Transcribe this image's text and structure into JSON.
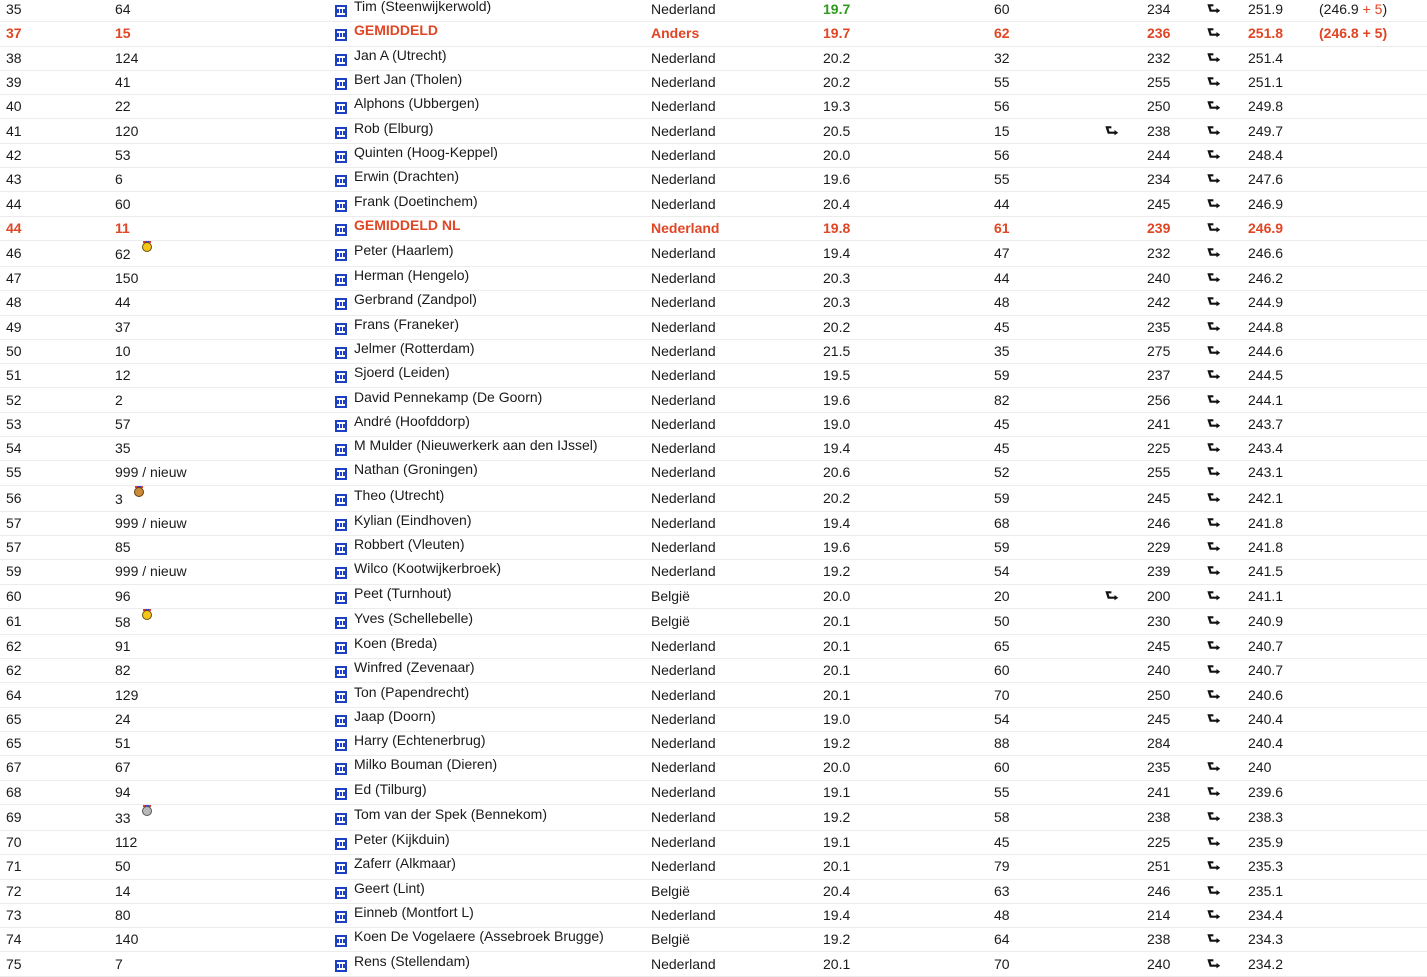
{
  "rows": [
    {
      "rank": "35",
      "pre": "64",
      "medal": "",
      "name": "Tim (Steenwijkerwold)",
      "country": "Nederland",
      "avg": "19.7",
      "n": "60",
      "a1": false,
      "score": "234",
      "a2": true,
      "total": "251.9",
      "extra": "(246.9 + 5)",
      "style": "green"
    },
    {
      "rank": "37",
      "pre": "15",
      "medal": "",
      "name": "GEMIDDELD",
      "country": "Anders",
      "avg": "19.7",
      "n": "62",
      "a1": false,
      "score": "236",
      "a2": true,
      "total": "251.8",
      "extra": "(246.8 + 5)",
      "style": "red"
    },
    {
      "rank": "38",
      "pre": "124",
      "medal": "",
      "name": "Jan A (Utrecht)",
      "country": "Nederland",
      "avg": "20.2",
      "n": "32",
      "a1": false,
      "score": "232",
      "a2": true,
      "total": "251.4",
      "extra": "",
      "style": ""
    },
    {
      "rank": "39",
      "pre": "41",
      "medal": "",
      "name": "Bert Jan (Tholen)",
      "country": "Nederland",
      "avg": "20.2",
      "n": "55",
      "a1": false,
      "score": "255",
      "a2": true,
      "total": "251.1",
      "extra": "",
      "style": ""
    },
    {
      "rank": "40",
      "pre": "22",
      "medal": "",
      "name": "Alphons (Ubbergen)",
      "country": "Nederland",
      "avg": "19.3",
      "n": "56",
      "a1": false,
      "score": "250",
      "a2": true,
      "total": "249.8",
      "extra": "",
      "style": ""
    },
    {
      "rank": "41",
      "pre": "120",
      "medal": "",
      "name": "Rob (Elburg)",
      "country": "Nederland",
      "avg": "20.5",
      "n": "15",
      "a1": true,
      "score": "238",
      "a2": true,
      "total": "249.7",
      "extra": "",
      "style": ""
    },
    {
      "rank": "42",
      "pre": "53",
      "medal": "",
      "name": "Quinten (Hoog-Keppel)",
      "country": "Nederland",
      "avg": "20.0",
      "n": "56",
      "a1": false,
      "score": "244",
      "a2": true,
      "total": "248.4",
      "extra": "",
      "style": ""
    },
    {
      "rank": "43",
      "pre": "6",
      "medal": "",
      "name": "Erwin (Drachten)",
      "country": "Nederland",
      "avg": "19.6",
      "n": "55",
      "a1": false,
      "score": "234",
      "a2": true,
      "total": "247.6",
      "extra": "",
      "style": ""
    },
    {
      "rank": "44",
      "pre": "60",
      "medal": "",
      "name": "Frank (Doetinchem)",
      "country": "Nederland",
      "avg": "20.4",
      "n": "44",
      "a1": false,
      "score": "245",
      "a2": true,
      "total": "246.9",
      "extra": "",
      "style": ""
    },
    {
      "rank": "44",
      "pre": "11",
      "medal": "",
      "name": "GEMIDDELD NL",
      "country": "Nederland",
      "avg": "19.8",
      "n": "61",
      "a1": false,
      "score": "239",
      "a2": true,
      "total": "246.9",
      "extra": "",
      "style": "red"
    },
    {
      "rank": "46",
      "pre": "62",
      "medal": "gold",
      "name": "Peter (Haarlem)",
      "country": "Nederland",
      "avg": "19.4",
      "n": "47",
      "a1": false,
      "score": "232",
      "a2": true,
      "total": "246.6",
      "extra": "",
      "style": ""
    },
    {
      "rank": "47",
      "pre": "150",
      "medal": "",
      "name": "Herman (Hengelo)",
      "country": "Nederland",
      "avg": "20.3",
      "n": "44",
      "a1": false,
      "score": "240",
      "a2": true,
      "total": "246.2",
      "extra": "",
      "style": ""
    },
    {
      "rank": "48",
      "pre": "44",
      "medal": "",
      "name": "Gerbrand (Zandpol)",
      "country": "Nederland",
      "avg": "20.3",
      "n": "48",
      "a1": false,
      "score": "242",
      "a2": true,
      "total": "244.9",
      "extra": "",
      "style": ""
    },
    {
      "rank": "49",
      "pre": "37",
      "medal": "",
      "name": "Frans (Franeker)",
      "country": "Nederland",
      "avg": "20.2",
      "n": "45",
      "a1": false,
      "score": "235",
      "a2": true,
      "total": "244.8",
      "extra": "",
      "style": ""
    },
    {
      "rank": "50",
      "pre": "10",
      "medal": "",
      "name": "Jelmer (Rotterdam)",
      "country": "Nederland",
      "avg": "21.5",
      "n": "35",
      "a1": false,
      "score": "275",
      "a2": true,
      "total": "244.6",
      "extra": "",
      "style": ""
    },
    {
      "rank": "51",
      "pre": "12",
      "medal": "",
      "name": "Sjoerd (Leiden)",
      "country": "Nederland",
      "avg": "19.5",
      "n": "59",
      "a1": false,
      "score": "237",
      "a2": true,
      "total": "244.5",
      "extra": "",
      "style": ""
    },
    {
      "rank": "52",
      "pre": "2",
      "medal": "",
      "name": "David Pennekamp (De Goorn)",
      "country": "Nederland",
      "avg": "19.6",
      "n": "82",
      "a1": false,
      "score": "256",
      "a2": true,
      "total": "244.1",
      "extra": "",
      "style": ""
    },
    {
      "rank": "53",
      "pre": "57",
      "medal": "",
      "name": "André (Hoofddorp)",
      "country": "Nederland",
      "avg": "19.0",
      "n": "45",
      "a1": false,
      "score": "241",
      "a2": true,
      "total": "243.7",
      "extra": "",
      "style": ""
    },
    {
      "rank": "54",
      "pre": "35",
      "medal": "",
      "name": "M Mulder (Nieuwerkerk aan den IJssel)",
      "country": "Nederland",
      "avg": "19.4",
      "n": "45",
      "a1": false,
      "score": "225",
      "a2": true,
      "total": "243.4",
      "extra": "",
      "style": ""
    },
    {
      "rank": "55",
      "pre": "999 / nieuw",
      "medal": "",
      "name": "Nathan (Groningen)",
      "country": "Nederland",
      "avg": "20.6",
      "n": "52",
      "a1": false,
      "score": "255",
      "a2": true,
      "total": "243.1",
      "extra": "",
      "style": ""
    },
    {
      "rank": "56",
      "pre": "3",
      "medal": "bronze",
      "name": "Theo (Utrecht)",
      "country": "Nederland",
      "avg": "20.2",
      "n": "59",
      "a1": false,
      "score": "245",
      "a2": true,
      "total": "242.1",
      "extra": "",
      "style": ""
    },
    {
      "rank": "57",
      "pre": "999 / nieuw",
      "medal": "",
      "name": "Kylian (Eindhoven)",
      "country": "Nederland",
      "avg": "19.4",
      "n": "68",
      "a1": false,
      "score": "246",
      "a2": true,
      "total": "241.8",
      "extra": "",
      "style": ""
    },
    {
      "rank": "57",
      "pre": "85",
      "medal": "",
      "name": "Robbert (Vleuten)",
      "country": "Nederland",
      "avg": "19.6",
      "n": "59",
      "a1": false,
      "score": "229",
      "a2": true,
      "total": "241.8",
      "extra": "",
      "style": ""
    },
    {
      "rank": "59",
      "pre": "999 / nieuw",
      "medal": "",
      "name": "Wilco (Kootwijkerbroek)",
      "country": "Nederland",
      "avg": "19.2",
      "n": "54",
      "a1": false,
      "score": "239",
      "a2": true,
      "total": "241.5",
      "extra": "",
      "style": ""
    },
    {
      "rank": "60",
      "pre": "96",
      "medal": "",
      "name": "Peet (Turnhout)",
      "country": "België",
      "avg": "20.0",
      "n": "20",
      "a1": true,
      "score": "200",
      "a2": true,
      "total": "241.1",
      "extra": "",
      "style": ""
    },
    {
      "rank": "61",
      "pre": "58",
      "medal": "gold",
      "name": "Yves (Schellebelle)",
      "country": "België",
      "avg": "20.1",
      "n": "50",
      "a1": false,
      "score": "230",
      "a2": true,
      "total": "240.9",
      "extra": "",
      "style": ""
    },
    {
      "rank": "62",
      "pre": "91",
      "medal": "",
      "name": "Koen (Breda)",
      "country": "Nederland",
      "avg": "20.1",
      "n": "65",
      "a1": false,
      "score": "245",
      "a2": true,
      "total": "240.7",
      "extra": "",
      "style": ""
    },
    {
      "rank": "62",
      "pre": "82",
      "medal": "",
      "name": "Winfred (Zevenaar)",
      "country": "Nederland",
      "avg": "20.1",
      "n": "60",
      "a1": false,
      "score": "240",
      "a2": true,
      "total": "240.7",
      "extra": "",
      "style": ""
    },
    {
      "rank": "64",
      "pre": "129",
      "medal": "",
      "name": "Ton (Papendrecht)",
      "country": "Nederland",
      "avg": "20.1",
      "n": "70",
      "a1": false,
      "score": "250",
      "a2": true,
      "total": "240.6",
      "extra": "",
      "style": ""
    },
    {
      "rank": "65",
      "pre": "24",
      "medal": "",
      "name": "Jaap (Doorn)",
      "country": "Nederland",
      "avg": "19.0",
      "n": "54",
      "a1": false,
      "score": "245",
      "a2": true,
      "total": "240.4",
      "extra": "",
      "style": ""
    },
    {
      "rank": "65",
      "pre": "51",
      "medal": "",
      "name": "Harry (Echtenerbrug)",
      "country": "Nederland",
      "avg": "19.2",
      "n": "88",
      "a1": false,
      "score": "284",
      "a2": false,
      "total": "240.4",
      "extra": "",
      "style": ""
    },
    {
      "rank": "67",
      "pre": "67",
      "medal": "",
      "name": "Milko Bouman (Dieren)",
      "country": "Nederland",
      "avg": "20.0",
      "n": "60",
      "a1": false,
      "score": "235",
      "a2": true,
      "total": "240",
      "extra": "",
      "style": ""
    },
    {
      "rank": "68",
      "pre": "94",
      "medal": "",
      "name": "Ed (Tilburg)",
      "country": "Nederland",
      "avg": "19.1",
      "n": "55",
      "a1": false,
      "score": "241",
      "a2": true,
      "total": "239.6",
      "extra": "",
      "style": ""
    },
    {
      "rank": "69",
      "pre": "33",
      "medal": "silver",
      "name": "Tom van der Spek (Bennekom)",
      "country": "Nederland",
      "avg": "19.2",
      "n": "58",
      "a1": false,
      "score": "238",
      "a2": true,
      "total": "238.3",
      "extra": "",
      "style": ""
    },
    {
      "rank": "70",
      "pre": "112",
      "medal": "",
      "name": "Peter (Kijkduin)",
      "country": "Nederland",
      "avg": "19.1",
      "n": "45",
      "a1": false,
      "score": "225",
      "a2": true,
      "total": "235.9",
      "extra": "",
      "style": ""
    },
    {
      "rank": "71",
      "pre": "50",
      "medal": "",
      "name": "Zaferr (Alkmaar)",
      "country": "Nederland",
      "avg": "20.1",
      "n": "79",
      "a1": false,
      "score": "251",
      "a2": true,
      "total": "235.3",
      "extra": "",
      "style": ""
    },
    {
      "rank": "72",
      "pre": "14",
      "medal": "",
      "name": "Geert (Lint)",
      "country": "België",
      "avg": "20.4",
      "n": "63",
      "a1": false,
      "score": "246",
      "a2": true,
      "total": "235.1",
      "extra": "",
      "style": ""
    },
    {
      "rank": "73",
      "pre": "80",
      "medal": "",
      "name": "Einneb (Montfort L)",
      "country": "Nederland",
      "avg": "19.4",
      "n": "48",
      "a1": false,
      "score": "214",
      "a2": true,
      "total": "234.4",
      "extra": "",
      "style": ""
    },
    {
      "rank": "74",
      "pre": "140",
      "medal": "",
      "name": "Koen De Vogelaere (Assebroek Brugge)",
      "country": "België",
      "avg": "19.2",
      "n": "64",
      "a1": false,
      "score": "238",
      "a2": true,
      "total": "234.3",
      "extra": "",
      "style": ""
    },
    {
      "rank": "75",
      "pre": "7",
      "medal": "",
      "name": "Rens (Stellendam)",
      "country": "Nederland",
      "avg": "20.1",
      "n": "70",
      "a1": false,
      "score": "240",
      "a2": true,
      "total": "234.2",
      "extra": "",
      "style": ""
    }
  ],
  "icons": {
    "team": "team-flag-icon",
    "arrow": "return-arrow-icon",
    "arrow_glyph": "⮐"
  },
  "colors": {
    "highlight_red": "#e04524",
    "highlight_green": "#2d9b1b",
    "team_icon_blue": "#1d3fc2"
  }
}
